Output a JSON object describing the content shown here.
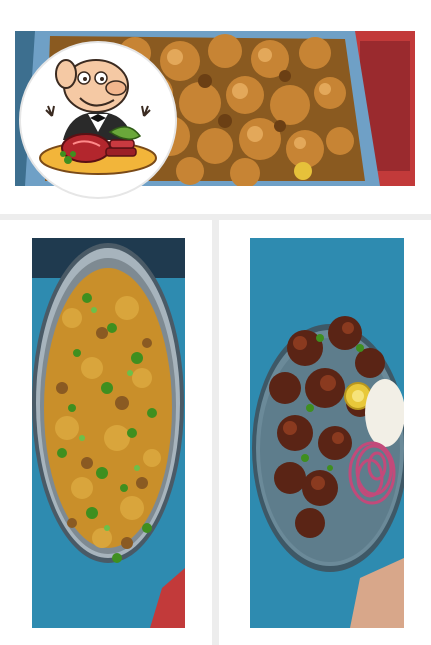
{
  "gallery": {
    "photos": [
      {
        "name": "fried-fritters-platter",
        "icon": "fried-food-photo"
      },
      {
        "name": "curry-bowl-with-coriander",
        "icon": "curry-photo"
      },
      {
        "name": "fried-chicken-with-onions",
        "icon": "fried-chicken-photo"
      }
    ],
    "badge": {
      "icon": "chef-with-meat-icon"
    }
  },
  "colors": {
    "background": "#ededed",
    "card": "#ffffff",
    "tray_blue": "#2f6f9a",
    "table_teal": "#2e8bb0",
    "fritter_brown": "#b36a2a",
    "curry_orange": "#c68a28",
    "coriander_green": "#3f8f1f",
    "onion_pink": "#c24a7a",
    "meat_red": "#b3262d"
  }
}
